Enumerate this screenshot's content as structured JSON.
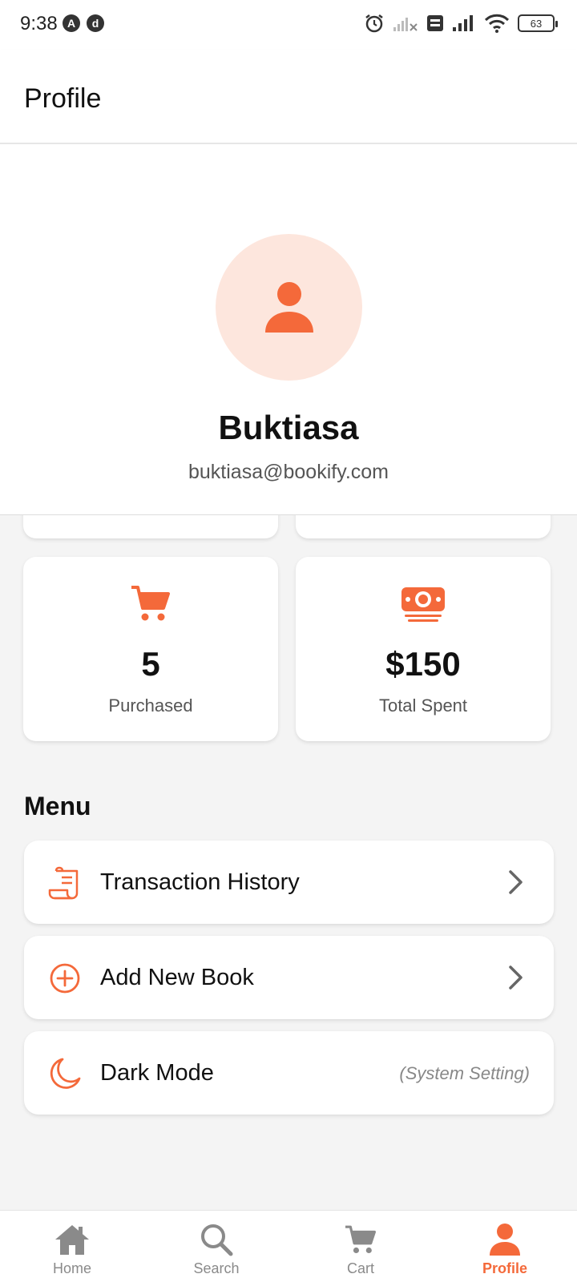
{
  "status": {
    "time": "9:38",
    "left_badges": [
      "A",
      "d"
    ],
    "battery": "63"
  },
  "header": {
    "title": "Profile"
  },
  "profile": {
    "name": "Buktiasa",
    "email": "buktiasa@bookify.com",
    "avatar_icon": "user-icon"
  },
  "stats": [
    {
      "icon": "cart-icon",
      "value": "5",
      "label": "Purchased"
    },
    {
      "icon": "money-icon",
      "value": "$150",
      "label": "Total Spent"
    }
  ],
  "menu": {
    "title": "Menu",
    "items": [
      {
        "icon": "receipt-icon",
        "label": "Transaction History",
        "trailing": "chevron"
      },
      {
        "icon": "plus-circle-icon",
        "label": "Add New Book",
        "trailing": "chevron"
      },
      {
        "icon": "moon-icon",
        "label": "Dark Mode",
        "note": "(System Setting)"
      }
    ]
  },
  "nav": {
    "items": [
      {
        "icon": "home-icon",
        "label": "Home",
        "active": false
      },
      {
        "icon": "search-icon",
        "label": "Search",
        "active": false
      },
      {
        "icon": "cart-icon",
        "label": "Cart",
        "active": false
      },
      {
        "icon": "person-icon",
        "label": "Profile",
        "active": true
      }
    ]
  },
  "colors": {
    "accent": "#f4693a",
    "avatar_bg": "#fde6dd",
    "page_bg": "#f4f4f4",
    "inactive": "#8a8a8a"
  }
}
